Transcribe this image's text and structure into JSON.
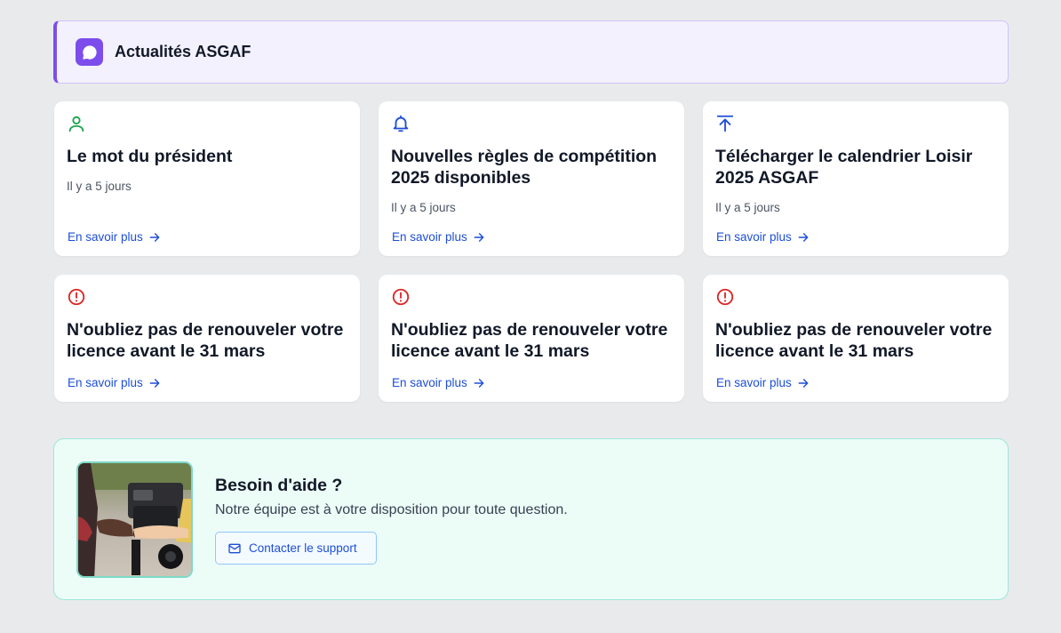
{
  "header": {
    "title": "Actualités ASGAF",
    "icon": "chat-bubble-icon",
    "accent": "#7c4dec"
  },
  "news": [
    {
      "icon": "user-icon",
      "icon_color": "#16a34a",
      "title": "Le mot du président",
      "date": "Il y a 5 jours",
      "more": "En savoir plus"
    },
    {
      "icon": "bell-icon",
      "icon_color": "#1d4ed8",
      "title": "Nouvelles règles de compétition 2025 disponibles",
      "date": "Il y a 5 jours",
      "more": "En savoir plus"
    },
    {
      "icon": "upload-icon",
      "icon_color": "#1d4ed8",
      "title": "Télécharger le calendrier Loisir 2025 ASGAF",
      "date": "Il y a 5 jours",
      "more": "En savoir plus"
    },
    {
      "icon": "alert-circle-icon",
      "icon_color": "#dc2626",
      "title": "N'oubliez pas de renouveler votre licence avant le 31 mars",
      "more": "En savoir plus"
    },
    {
      "icon": "alert-circle-icon",
      "icon_color": "#dc2626",
      "title": "N'oubliez pas de renouveler votre licence avant le 31 mars",
      "more": "En savoir plus"
    },
    {
      "icon": "alert-circle-icon",
      "icon_color": "#dc2626",
      "title": "N'oubliez pas de renouveler votre licence avant le 31 mars",
      "more": "En savoir plus"
    }
  ],
  "help": {
    "title": "Besoin d'aide ?",
    "text": "Notre équipe est à votre disposition pour toute question.",
    "button": "Contacter le support",
    "button_icon": "mail-icon"
  }
}
